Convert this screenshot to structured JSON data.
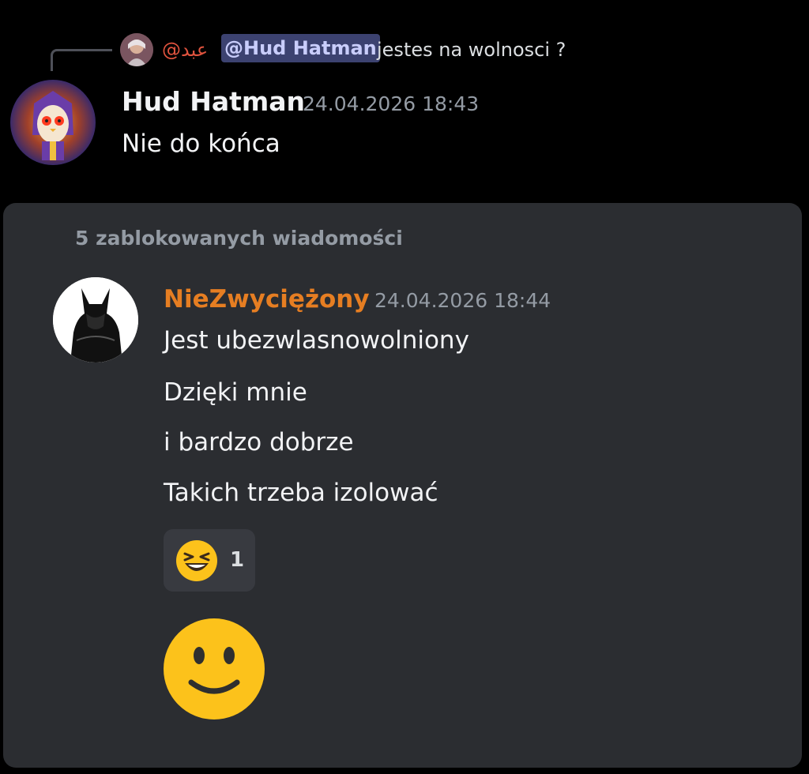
{
  "reply": {
    "author": "@عبد",
    "mention": "@Hud Hatman",
    "text": "jestes na wolnosci ?"
  },
  "message1": {
    "author": "Hud Hatman",
    "timestamp": "24.04.2026 18:43",
    "text": "Nie do końca"
  },
  "blocked": {
    "label": "5 zablokowanych wiadomości",
    "message": {
      "author": "NieZwyciężony",
      "author_color": "#e67e22",
      "timestamp": "24.04.2026 18:44",
      "lines": [
        "Jest ubezwlasnowolniony",
        "Dzięki mnie",
        "i bardzo dobrze",
        "Takich trzeba izolować"
      ],
      "reaction": {
        "emoji": "laughing-face-icon",
        "count": "1"
      },
      "sticker": "slightly-smiling-face-icon"
    }
  }
}
